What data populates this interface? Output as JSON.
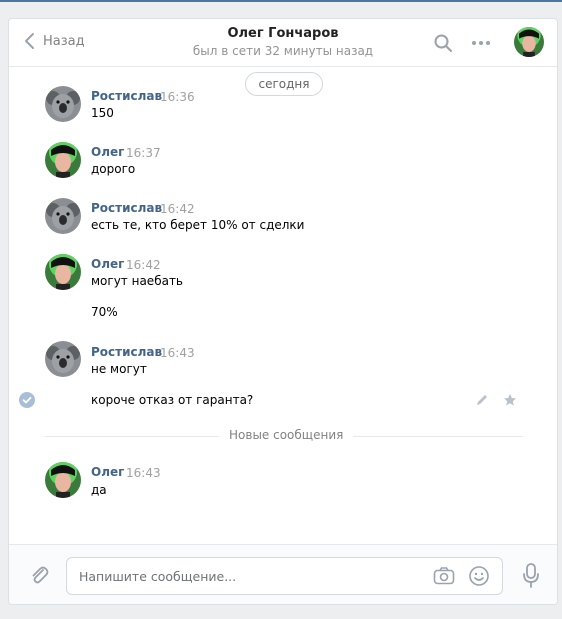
{
  "header": {
    "back_label": "Назад",
    "peer_name": "Олег Гончаров",
    "peer_status": "был в сети 32 минуты назад"
  },
  "date_label": "сегодня",
  "messages": [
    {
      "author": "Ростислав",
      "time": "16:36",
      "avatar": "koala-avatar",
      "lines": [
        "150"
      ]
    },
    {
      "author": "Олег",
      "time": "16:37",
      "avatar": "oleg-avatar",
      "lines": [
        "дорого"
      ]
    },
    {
      "author": "Ростислав",
      "time": "16:42",
      "avatar": "koala-avatar",
      "lines": [
        "есть те, кто берет 10% от сделки"
      ]
    },
    {
      "author": "Олег",
      "time": "16:42",
      "avatar": "oleg-avatar",
      "lines": [
        "могут наебать",
        "70%"
      ]
    },
    {
      "author": "Ростислав",
      "time": "16:43",
      "avatar": "koala-avatar",
      "lines": [
        "не могут",
        "короче отказ от гаранта?"
      ]
    },
    {
      "author": "Олег",
      "time": "16:43",
      "avatar": "oleg-avatar",
      "lines": [
        "да"
      ]
    }
  ],
  "divider_label": "Новые сообщения",
  "composer": {
    "placeholder": "Напишите сообщение..."
  },
  "colors": {
    "accent": "#4a76a8",
    "author_link": "#42648b",
    "icon_gray": "#99a2ad"
  }
}
